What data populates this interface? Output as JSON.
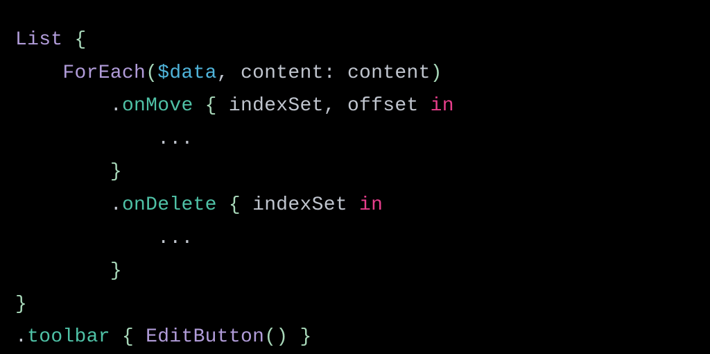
{
  "code": {
    "line1": {
      "list": "List",
      "openBrace": "{"
    },
    "line2": {
      "foreach": "ForEach",
      "openParen": "(",
      "data": "$data",
      "comma1": ",",
      "contentLabel": "content",
      "colon": ":",
      "contentValue": "content",
      "closeParen": ")"
    },
    "line3": {
      "dot": ".",
      "onMove": "onMove",
      "openBrace": "{",
      "indexSet": "indexSet",
      "comma": ",",
      "offset": "offset",
      "in": "in"
    },
    "line4": {
      "ellipsis": "..."
    },
    "line5": {
      "closeBrace": "}"
    },
    "line6": {
      "dot": ".",
      "onDelete": "onDelete",
      "openBrace": "{",
      "indexSet": "indexSet",
      "in": "in"
    },
    "line7": {
      "ellipsis": "..."
    },
    "line8": {
      "closeBrace": "}"
    },
    "line9": {
      "closeBrace": "}"
    },
    "line10": {
      "dot": ".",
      "toolbar": "toolbar",
      "openBrace": "{",
      "editButton": "EditButton",
      "openParen": "(",
      "closeParen": ")",
      "closeBrace": "}"
    }
  }
}
